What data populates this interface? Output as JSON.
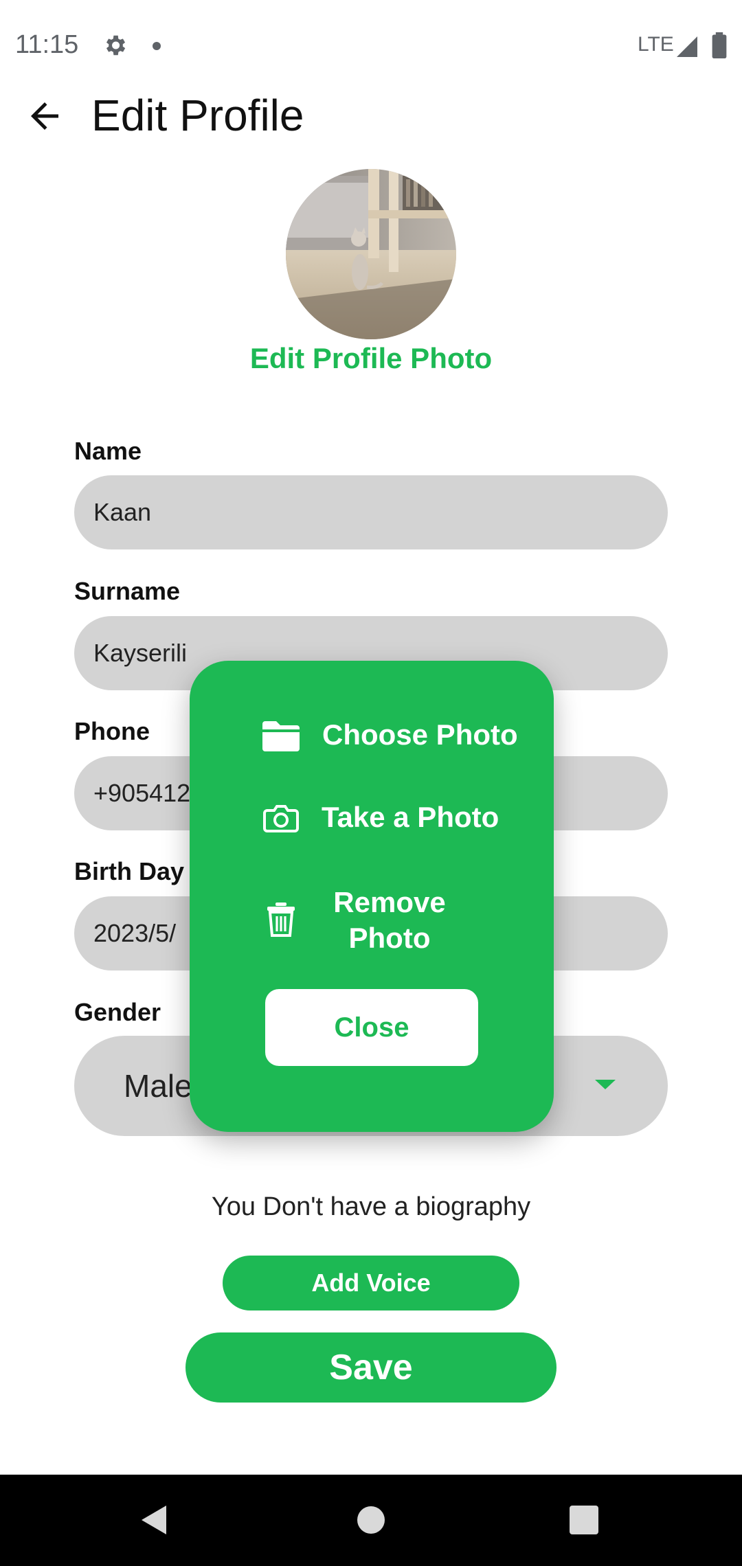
{
  "status_bar": {
    "time": "11:15",
    "network": "LTE",
    "icons": [
      "gear-icon",
      "notification-dot-icon",
      "signal-icon",
      "battery-icon"
    ]
  },
  "app_bar": {
    "title": "Edit Profile",
    "back_icon": "arrow-left-icon"
  },
  "profile": {
    "edit_photo_label": "Edit Profile Photo"
  },
  "form": {
    "name": {
      "label": "Name",
      "value": "Kaan"
    },
    "surname": {
      "label": "Surname",
      "value": "Kayserili"
    },
    "phone": {
      "label": "Phone",
      "value": "+905412"
    },
    "birthday": {
      "label": "Birth Day",
      "value": "2023/5/"
    },
    "gender": {
      "label": "Gender",
      "value": "Male"
    }
  },
  "biography": {
    "empty_text": "You Don't have a biography"
  },
  "buttons": {
    "add_voice": "Add Voice",
    "save": "Save"
  },
  "photo_dialog": {
    "choose_photo": "Choose Photo",
    "take_photo": "Take a Photo",
    "remove_photo_line1": "Remove",
    "remove_photo_line2": "Photo",
    "close": "Close"
  },
  "colors": {
    "accent": "#1db954",
    "input_bg": "#d3d3d3",
    "nav_bar": "#000000"
  }
}
